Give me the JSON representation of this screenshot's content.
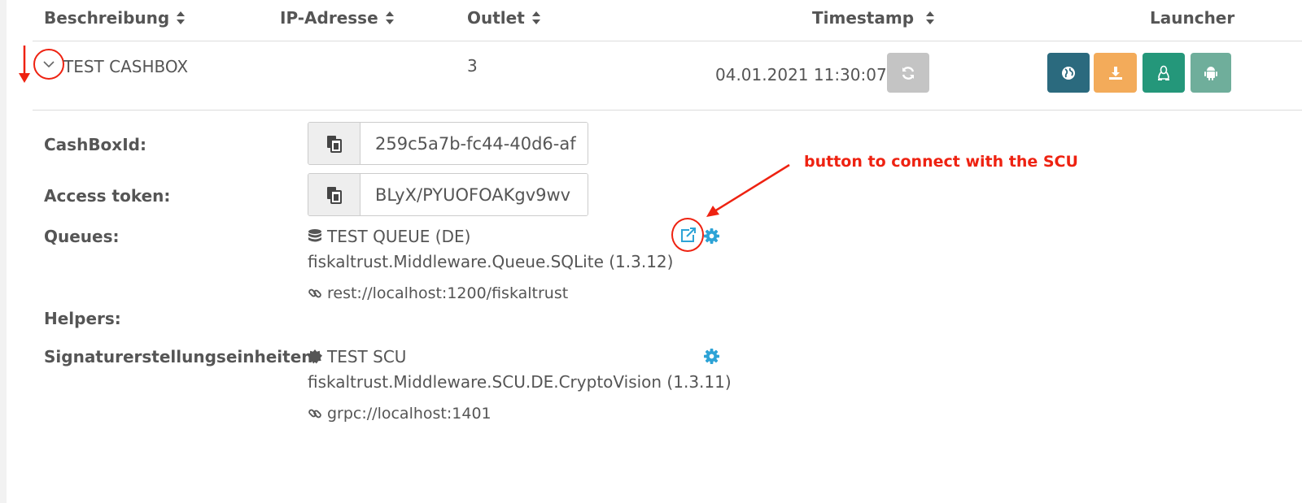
{
  "table": {
    "headers": {
      "description": "Beschreibung",
      "ip": "IP-Adresse",
      "outlet": "Outlet",
      "timestamp": "Timestamp",
      "launcher": "Launcher"
    },
    "row": {
      "description": "TEST CASHBOX",
      "ip": "",
      "outlet": "3",
      "timestamp": "04.01.2021 11:30:07"
    }
  },
  "details": {
    "cashbox_id_label": "CashBoxId:",
    "cashbox_id_value": "259c5a7b-fc44-40d6-af",
    "access_token_label": "Access token:",
    "access_token_value": "BLyX/PYUOFOAKgv9wv",
    "queues_label": "Queues:",
    "queue": {
      "name": "TEST QUEUE (DE)",
      "package": "fiskaltrust.Middleware.Queue.SQLite (1.3.12)",
      "url": "rest://localhost:1200/fiskaltrust"
    },
    "helpers_label": "Helpers:",
    "scu_label": "Signaturerstellungseinheiten:",
    "scu": {
      "name": "TEST SCU",
      "package": "fiskaltrust.Middleware.SCU.DE.CryptoVision (1.3.11)",
      "url": "grpc://localhost:1401"
    }
  },
  "annotation": {
    "text": "button to connect with the SCU"
  },
  "icons": {
    "sort": "sort-icon",
    "chevron": "chevron-down-icon",
    "refresh": "refresh-icon",
    "globe": "globe-icon",
    "download": "download-icon",
    "linux": "linux-icon",
    "android": "android-icon",
    "copy": "copy-icon",
    "database": "database-icon",
    "link": "link-icon",
    "external": "external-link-icon",
    "gear": "gear-icon",
    "certificate": "certificate-icon"
  },
  "colors": {
    "launcher_windows": "#2b6a7e",
    "launcher_download": "#f3ab5a",
    "launcher_linux": "#24977a",
    "launcher_android": "#6fae9b",
    "refresh_button": "#c4c4c4",
    "accent": "#2da3d6",
    "annotation": "#ee2211"
  }
}
